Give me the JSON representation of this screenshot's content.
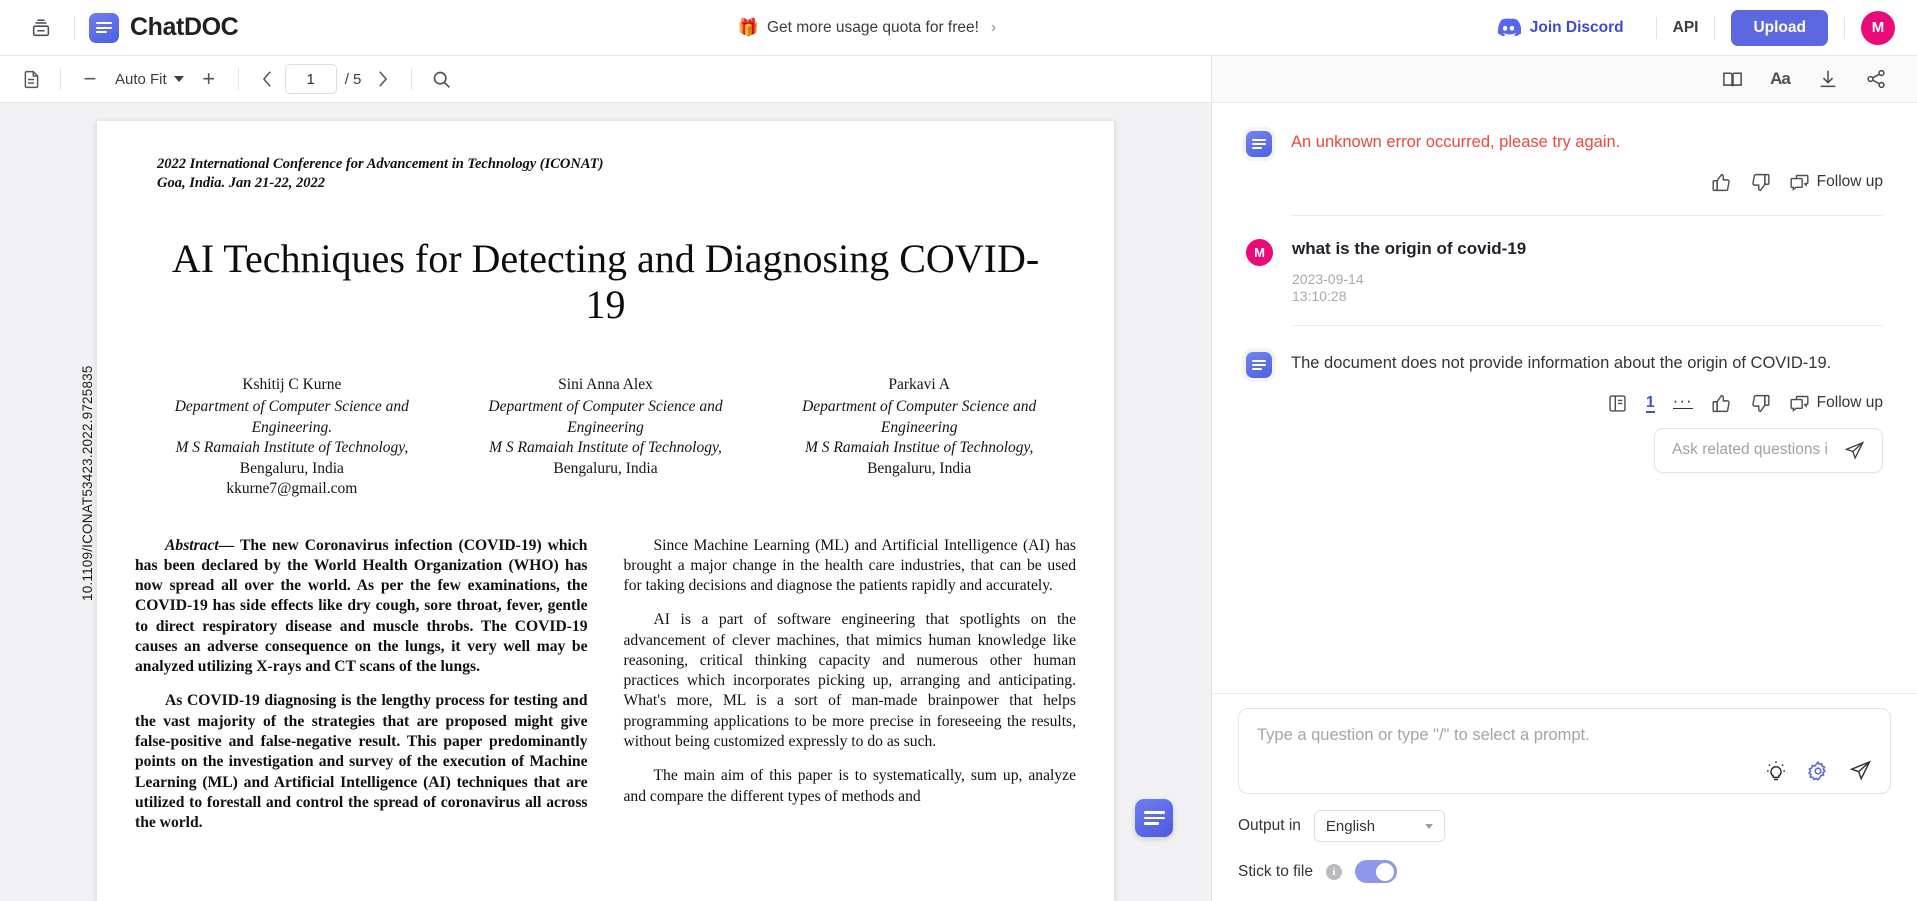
{
  "header": {
    "sidebar_toggle_icon": "panel-toggle-icon",
    "brand_name": "ChatDOC",
    "brand_logo_icon": "chatdoc-logo-icon",
    "promo_icon": "gift-icon",
    "promo_text": "Get more usage quota for free!",
    "promo_chevron": "›",
    "discord_icon": "discord-icon",
    "discord_label": "Join Discord",
    "api_label": "API",
    "upload_label": "Upload",
    "avatar_initial": "M",
    "avatar_color": "#ea0a78",
    "accent_color": "#5b68e0"
  },
  "toolbar": {
    "outline_icon": "document-outline-icon",
    "zoom_out": "−",
    "zoom_level": "Auto Fit",
    "zoom_in": "+",
    "prev_page_icon": "chevron-left-icon",
    "page_value": "1",
    "page_total": "/ 5",
    "next_page_icon": "chevron-right-icon",
    "search_icon": "search-icon"
  },
  "document": {
    "doi": "10.1109/ICONAT53423.2022.9725835",
    "conference_line1": "2022 International Conference for Advancement in Technology (ICONAT)",
    "conference_line2": "Goa, India. Jan 21-22, 2022",
    "title": "AI Techniques for Detecting and Diagnosing COVID-19",
    "authors": [
      {
        "name": "Kshitij C Kurne",
        "dept": "Department of Computer Science and Engineering.",
        "institute": "M S Ramaiah Institute of Technology,",
        "city": "Bengaluru, India",
        "email": "kkurne7@gmail.com"
      },
      {
        "name": "Sini Anna Alex",
        "dept": "Department of Computer Science and Engineering",
        "institute": "M S Ramaiah Institute of Technology,",
        "city": "Bengaluru, India",
        "email": ""
      },
      {
        "name": "Parkavi A",
        "dept": "Department of Computer Science and Engineering",
        "institute": "M S Ramaiah Institue of Technology,",
        "city": "Bengaluru, India",
        "email": ""
      }
    ],
    "abstract_label": "Abstract—",
    "abstract_p1": "The new Coronavirus infection (COVID-19) which has been declared by the World Health Organization (WHO) has now spread all over the world. As per the few examinations, the COVID-19 has side effects like dry cough, sore throat, fever, gentle to direct respiratory disease and muscle throbs. The COVID-19 causes an adverse consequence on the lungs, it very well may be analyzed utilizing X-rays and CT scans of the lungs.",
    "abstract_p2": "As COVID-19 diagnosing is the lengthy process for testing and the vast majority of the strategies that are proposed might give false-positive and false-negative result. This paper predominantly points on the investigation and survey of the execution of Machine Learning (ML) and Artificial Intelligence (AI) techniques that are utilized to forestall and control the spread of coronavirus all across the world.",
    "intro_p1": "Since Machine Learning (ML) and Artificial Intelligence (AI) has brought a major change in the health care industries, that can be used for taking decisions and diagnose the patients rapidly and accurately.",
    "intro_p2": "AI is a part of software engineering that spotlights on the advancement of clever machines, that mimics human knowledge like reasoning, critical thinking capacity and numerous other human practices which incorporates picking up, arranging and anticipating. What's more, ML is a sort of man-made brainpower that helps programming applications to be more precise in foreseeing the results, without being customized expressly to do as such.",
    "intro_p3": "The main aim of this paper is to systematically, sum up, analyze and compare the different types of methods and",
    "float_chat_icon": "chat-bubble-icon"
  },
  "chat_toolbar": {
    "read_mode_icon": "book-icon",
    "font_size_icon": "font-size-icon",
    "font_size_label": "Aa",
    "download_icon": "download-icon",
    "share_icon": "share-icon"
  },
  "thread": {
    "error_message": {
      "icon": "chatdoc-bot-icon",
      "text": "An unknown error occurred, please try again.",
      "color": "#f2483a",
      "actions": {
        "like_icon": "thumbs-up-icon",
        "dislike_icon": "thumbs-down-icon",
        "followup_icon": "followup-icon",
        "followup_label": "Follow up"
      }
    },
    "question": {
      "avatar_initial": "M",
      "text": "what is the origin of covid-19",
      "date": "2023-09-14",
      "time": "13:10:28"
    },
    "answer": {
      "icon": "chatdoc-bot-icon",
      "text": "The document does not provide information about the origin of COVID-19.",
      "actions": {
        "source_icon": "source-page-icon",
        "reference_number": "1",
        "more_icon": "more-icon",
        "more_label": "···",
        "like_icon": "thumbs-up-icon",
        "dislike_icon": "thumbs-down-icon",
        "followup_icon": "followup-icon",
        "followup_label": "Follow up"
      }
    },
    "related": {
      "text": "Ask related questions i",
      "send_icon": "send-icon"
    }
  },
  "composer": {
    "placeholder": "Type a question or type \"/\" to select a prompt.",
    "value": "",
    "prompt_icon": "lightbulb-icon",
    "settings_icon": "gear-icon",
    "send_icon": "send-icon",
    "settings_color": "#5b68e0"
  },
  "options": {
    "output_label": "Output in",
    "output_value": "English",
    "output_chevron_icon": "chevron-down-icon",
    "stick_label": "Stick to file",
    "stick_info_icon": "info-icon",
    "stick_enabled": true,
    "toggle_color": "#8d97ee"
  }
}
